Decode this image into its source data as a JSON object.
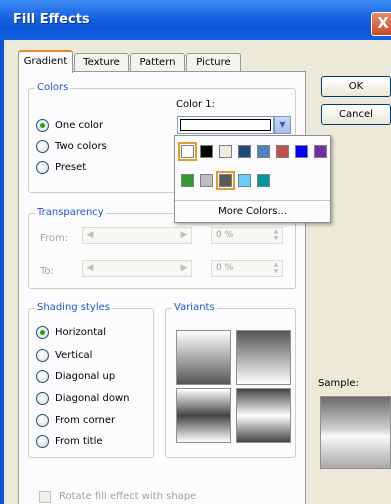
{
  "window": {
    "title": "Fill Effects",
    "close_label": "X"
  },
  "tabs": [
    "Gradient",
    "Texture",
    "Pattern",
    "Picture"
  ],
  "colors_group": {
    "legend": "Colors",
    "options": [
      "One color",
      "Two colors",
      "Preset"
    ],
    "selected": "One color",
    "color1_label": "Color 1:"
  },
  "palette": {
    "row1": [
      "#ffffff",
      "#000000",
      "#eeece1",
      "#1f497d",
      "#4f81bd",
      "#c0504d",
      "#0000ff",
      "#7030a0"
    ],
    "row2": [
      "#339933",
      "#bfbfbf",
      "#595959",
      "#66ccff",
      "#009999"
    ],
    "selected_row2_index": 2,
    "more_colors": "More Colors..."
  },
  "transparency_group": {
    "legend": "Transparency",
    "from_label": "From:",
    "to_label": "To:",
    "from_value": "0 %",
    "to_value": "0 %"
  },
  "shading_group": {
    "legend": "Shading styles",
    "options": [
      "Horizontal",
      "Vertical",
      "Diagonal up",
      "Diagonal down",
      "From corner",
      "From title"
    ],
    "selected": "Horizontal"
  },
  "variants_group": {
    "legend": "Variants"
  },
  "buttons": {
    "ok": "OK",
    "cancel": "Cancel"
  },
  "sample_label": "Sample:",
  "rotate_checkbox_label": "Rotate fill effect with shape"
}
